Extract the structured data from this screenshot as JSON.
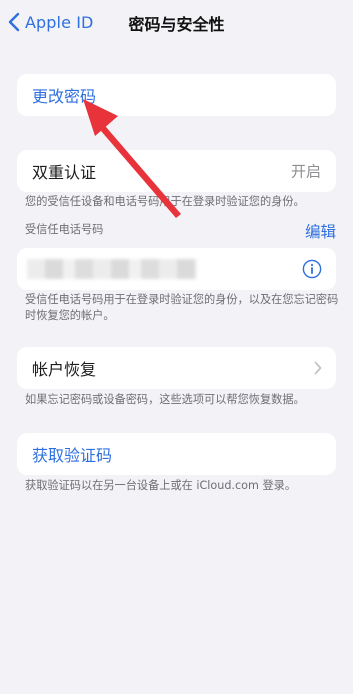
{
  "navbar": {
    "back_label": "Apple ID",
    "title": "密码与安全性"
  },
  "change_password": {
    "label": "更改密码"
  },
  "two_factor": {
    "label": "双重认证",
    "value": "开启",
    "note": "您的受信任设备和电话号码用于在登录时验证您的身份。"
  },
  "trusted_numbers": {
    "header": "受信任电话号码",
    "edit_label": "编辑",
    "note": "受信任电话号码用于在登录时验证您的身份，以及在您忘记密码时恢复您的帐户。"
  },
  "account_recovery": {
    "label": "帐户恢复",
    "note": "如果忘记密码或设备密码，这些选项可以帮您恢复数据。"
  },
  "verification_code": {
    "label": "获取验证码",
    "note": "获取验证码以在另一台设备上或在 iCloud.com 登录。"
  },
  "colors": {
    "accent": "#2f6fe0",
    "background": "#f2f2f7",
    "annotation_arrow": "#e8333a"
  }
}
